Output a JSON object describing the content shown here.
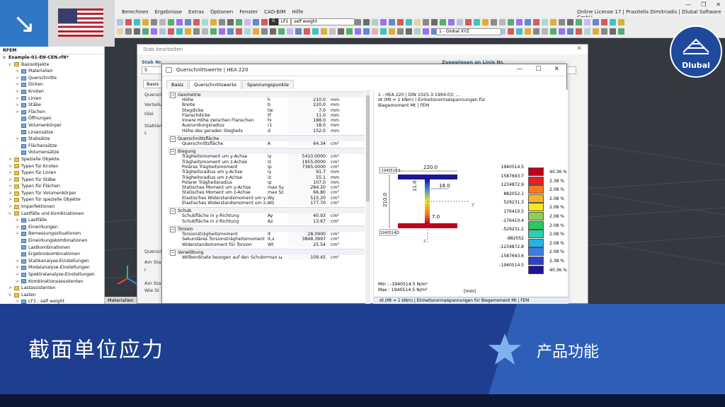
{
  "app": {
    "menus": [
      "Berechnen",
      "Ergebnisse",
      "Extras",
      "Optionen",
      "Fenster",
      "CAD-BIM",
      "Hilfe"
    ],
    "license": "Online License 17 | Praxitelis Dimitriadis | Dlubal Software GmbH",
    "lc_group": "G",
    "lc_number": "LF1",
    "lc_name": "self weight",
    "coord_system": "1 - Global XYZ"
  },
  "navigator": {
    "title": "RFEM",
    "model": "Example-01-EN-CEN.rf6*",
    "items": [
      {
        "label": "Basisobjekte",
        "level": 1,
        "arrow": "v"
      },
      {
        "label": "Materialien",
        "level": 2,
        "arrow": ">"
      },
      {
        "label": "Querschnitte",
        "level": 2,
        "arrow": ">"
      },
      {
        "label": "Dicken",
        "level": 2,
        "arrow": ">"
      },
      {
        "label": "Knoten",
        "level": 2,
        "arrow": ">"
      },
      {
        "label": "Linien",
        "level": 2,
        "arrow": ">"
      },
      {
        "label": "Stäbe",
        "level": 2,
        "arrow": ">"
      },
      {
        "label": "Flächen",
        "level": 2,
        "arrow": ">"
      },
      {
        "label": "Öffnungen",
        "level": 2,
        "arrow": ""
      },
      {
        "label": "Volumenkörper",
        "level": 2,
        "arrow": ""
      },
      {
        "label": "Liniensätze",
        "level": 2,
        "arrow": ""
      },
      {
        "label": "Stabsätze",
        "level": 2,
        "arrow": ">"
      },
      {
        "label": "Flächensätze",
        "level": 2,
        "arrow": ""
      },
      {
        "label": "Volumensätze",
        "level": 2,
        "arrow": ""
      },
      {
        "label": "Spezielle Objekte",
        "level": 1,
        "arrow": ">"
      },
      {
        "label": "Typen für Knoten",
        "level": 1,
        "arrow": ">"
      },
      {
        "label": "Typen für Linien",
        "level": 1,
        "arrow": ">"
      },
      {
        "label": "Typen für Stäbe",
        "level": 1,
        "arrow": ">"
      },
      {
        "label": "Typen für Flächen",
        "level": 1,
        "arrow": ">"
      },
      {
        "label": "Typen für Volumenkörper",
        "level": 1,
        "arrow": ">"
      },
      {
        "label": "Typen für spezielle Objekte",
        "level": 1,
        "arrow": ">"
      },
      {
        "label": "Imperfektionen",
        "level": 1,
        "arrow": ">"
      },
      {
        "label": "Lastfälle und Kombinationen",
        "level": 1,
        "arrow": "v"
      },
      {
        "label": "Lastfälle",
        "level": 2,
        "arrow": ">"
      },
      {
        "label": "Einwirkungen",
        "level": 2,
        "arrow": ">"
      },
      {
        "label": "Bemessungssituationen",
        "level": 2,
        "arrow": ">"
      },
      {
        "label": "Einwirkungskombinationen",
        "level": 2,
        "arrow": ""
      },
      {
        "label": "Lastkombinationen",
        "level": 2,
        "arrow": ""
      },
      {
        "label": "Ergebniskombinationen",
        "level": 2,
        "arrow": ""
      },
      {
        "label": "Statikanalyse-Einstellungen",
        "level": 2,
        "arrow": ">"
      },
      {
        "label": "Modalanalyse-Einstellungen",
        "level": 2,
        "arrow": ">"
      },
      {
        "label": "Spektralanalyse-Einstellungen",
        "level": 2,
        "arrow": ">"
      },
      {
        "label": "Kombinationsassistenten",
        "level": 2,
        "arrow": ">"
      },
      {
        "label": "Lastassistenten",
        "level": 1,
        "arrow": ">"
      },
      {
        "label": "Lasten",
        "level": 1,
        "arrow": "v"
      },
      {
        "label": "LF1 - self weight",
        "level": 2,
        "arrow": ">"
      }
    ]
  },
  "viewport": {
    "materialien_tab": "Materialien"
  },
  "stab_dialog": {
    "title": "Stab bearbeiten",
    "stab_nr_label": "Stab Nr.",
    "stab_nr_value": "5",
    "assigned_label": "Zugewiesen an Linie Nr.",
    "tab_basis": "Basis",
    "side_labels": [
      "Quersch",
      "Verteilu",
      "Glei",
      "Stablän",
      "L",
      "Quersch",
      "Am Stab",
      "I",
      "Am Stab",
      "Wie St"
    ]
  },
  "qs_dialog": {
    "title": "Querschnittswerte | HEA 220",
    "tabs": [
      "Basis",
      "Querschnittswerte",
      "Spannungspunkte"
    ],
    "sections": [
      {
        "title": "Geometrie",
        "rows": [
          [
            "Höhe",
            "h",
            "210.0",
            "mm"
          ],
          [
            "Breite",
            "b",
            "220.0",
            "mm"
          ],
          [
            "Stegdicke",
            "tw",
            "7.0",
            "mm"
          ],
          [
            "Flanschdicke",
            "tf",
            "11.0",
            "mm"
          ],
          [
            "Innere Höhe zwischen Flanschen",
            "hi",
            "188.0",
            "mm"
          ],
          [
            "Ausrundungsradius",
            "r1",
            "18.0",
            "mm"
          ],
          [
            "Höhe des geraden Stegteils",
            "d",
            "152.0",
            "mm"
          ]
        ]
      },
      {
        "title": "Querschnittsfläche",
        "rows": [
          [
            "Querschnittsfläche",
            "A",
            "64.34",
            "cm²"
          ]
        ]
      },
      {
        "title": "Biegung",
        "rows": [
          [
            "Trägheitsmoment um y-Achse",
            "Iy",
            "5410.0000",
            "cm⁴"
          ],
          [
            "Trägheitsmoment um z-Achse",
            "Iz",
            "1955.0000",
            "cm⁴"
          ],
          [
            "Polares Trägheitsmoment",
            "Ip",
            "7365.0000",
            "cm⁴"
          ],
          [
            "Trägheitsradius um y-Achse",
            "iy",
            "91.7",
            "mm"
          ],
          [
            "Trägheitsradius um z-Achse",
            "iz",
            "55.1",
            "mm"
          ],
          [
            "Polarer Trägheitsradius",
            "ip",
            "107.0",
            "mm"
          ],
          [
            "Statisches Moment um y-Achse",
            "max Sy",
            "284.20",
            "cm³"
          ],
          [
            "Statisches Moment um z-Achse",
            "max Sz",
            "66.80",
            "cm³"
          ],
          [
            "Elastisches Widerstandsmoment um y-Achse",
            "Wy",
            "515.20",
            "cm³"
          ],
          [
            "Elastisches Widerstandsmoment um z-Achse",
            "Wz",
            "177.70",
            "cm³"
          ]
        ]
      },
      {
        "title": "Schub",
        "rows": [
          [
            "Schubfläche in y-Richtung",
            "Ay",
            "40.93",
            "cm²"
          ],
          [
            "Schubfläche in z-Richtung",
            "Az",
            "13.67",
            "cm²"
          ]
        ]
      },
      {
        "title": "Torsion",
        "rows": [
          [
            "Torsionsträgheitsmoment",
            "It",
            "28.0900",
            "cm⁴"
          ],
          [
            "Sekundäres Torsionsträgheitsmoment",
            "It,s",
            "3848.3997",
            "cm⁴"
          ],
          [
            "Widerstandsmoment für Torsion",
            "Wt",
            "25.54",
            "cm³"
          ]
        ]
      },
      {
        "title": "Verwölbung",
        "rows": [
          [
            "Wölbordinate bezogen auf den Schubmittelpu...",
            "max ω",
            "109.45",
            "cm²"
          ]
        ]
      }
    ],
    "caption_line1": "1 - HEA 220 | DIN 1025-3:1994-03; ...",
    "caption_line2": "σt (Mt = 1 kNm) | Einheitsnormalspannungen für",
    "caption_line3": "Biegemoment Mt | FEM",
    "dim_width": "220.0",
    "dim_height": "210.0",
    "dim_flange": "11.0",
    "dim_r": "18.0",
    "dim_web": "7.0",
    "tag_top": "-1940514.5",
    "tag_bottom": "1940514.5",
    "axis_y": "y",
    "axis_z": "z",
    "min_text": "Min : -1940514.5 N/m²",
    "max_text": "Max : 1940514.5 N/m²",
    "mm_unit": "[mm]",
    "bottom_select": "σt (Mt = 1 kNm) | Einheitsnormalspannungen für Biegemoment Mt | FEM",
    "legend": [
      {
        "value": "1940514.5",
        "pct": "40.36 %",
        "color": "#c0001a"
      },
      {
        "value": "1587693.7",
        "pct": "2.38 %",
        "color": "#ee1c24"
      },
      {
        "value": "1234872.9",
        "pct": "2.08 %",
        "color": "#f57b20"
      },
      {
        "value": "882052.1",
        "pct": "2.08 %",
        "color": "#fbb21b"
      },
      {
        "value": "529231.3",
        "pct": "2.08 %",
        "color": "#f4e81f"
      },
      {
        "value": "176410.5",
        "pct": "2.08 %",
        "color": "#8fd14f"
      },
      {
        "value": "-176410.4",
        "pct": "2.08 %",
        "color": "#2cc95e"
      },
      {
        "value": "-529231.2",
        "pct": "2.08 %",
        "color": "#25d2b0"
      },
      {
        "value": "-882052",
        "pct": "2.08 %",
        "color": "#20b5e6"
      },
      {
        "value": "-1234872.8",
        "pct": "2.08 %",
        "color": "#3b7de0"
      },
      {
        "value": "-1587693.6",
        "pct": "2.38 %",
        "color": "#2f3fce"
      },
      {
        "value": "-1940514.5",
        "pct": "40.36 %",
        "color": "#1b1699"
      }
    ]
  },
  "banner": {
    "title": "截面单位应力",
    "subtitle": "产品功能",
    "logo_text": "Dlubal"
  }
}
